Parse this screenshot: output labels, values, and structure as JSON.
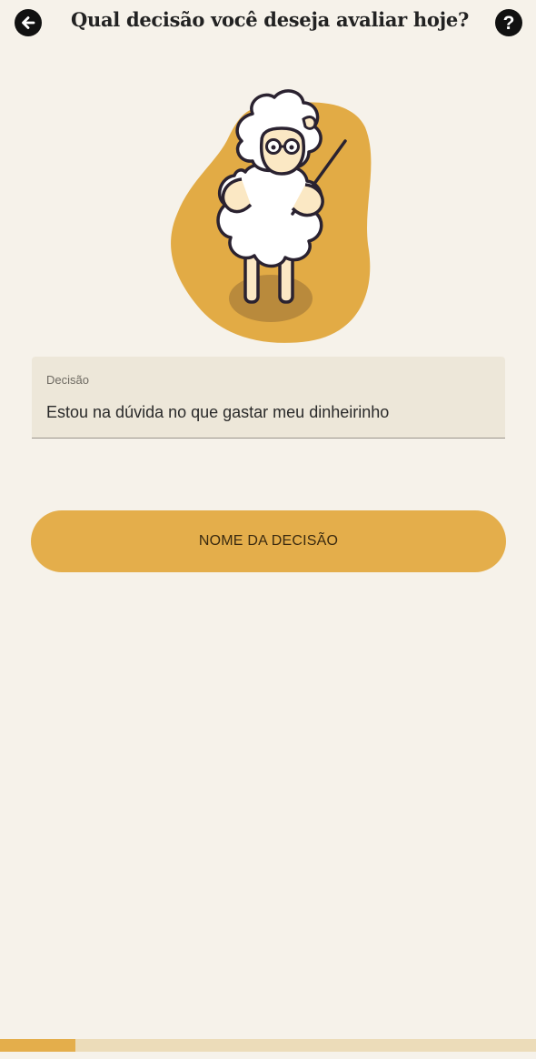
{
  "header": {
    "back_icon": "arrow-left-icon",
    "title": "Qual decisão você deseja avaliar hoje?",
    "help_icon": "question-mark-icon",
    "help_glyph": "?"
  },
  "illustration": {
    "subject": "sheep-with-stick-illustration"
  },
  "field": {
    "label": "Decisão",
    "value": "Estou na dúvida no que gastar meu dinheirinho"
  },
  "action": {
    "label": "NOME DA DECISÃO"
  },
  "progress": {
    "fraction": 0.14
  },
  "colors": {
    "background": "#f6f2ea",
    "accent": "#e4ae4b",
    "progress_track": "#ecdcb9",
    "field_bg": "#ede7d9"
  }
}
